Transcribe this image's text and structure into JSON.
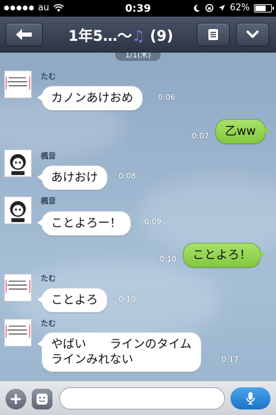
{
  "status_bar": {
    "carrier": "au",
    "time": "0:39",
    "battery_text": "62%",
    "battery_level": 0.62
  },
  "header": {
    "title": "1年5…〜",
    "title_note": "♫",
    "member_count": "(9)"
  },
  "date_label": "1/1(木)",
  "messages": [
    {
      "sender": "たむ",
      "text": "カノンあけおめ",
      "time": "0:06"
    },
    {
      "text": "乙ww",
      "time": "0:07"
    },
    {
      "sender": "楓音",
      "text": "あけおけ",
      "time": "0:08"
    },
    {
      "sender": "楓音",
      "text": "ことよろー！",
      "time": "0:09"
    },
    {
      "text": "ことよろ！",
      "time": "0:10"
    },
    {
      "sender": "たむ",
      "text": "ことよろ",
      "time": "0:10"
    },
    {
      "sender": "たむ",
      "text_line1": "やばい　　ラインのタイム",
      "text_line2": "ラインみれない",
      "time": "0:17"
    }
  ],
  "input": {
    "placeholder": ""
  },
  "colors": {
    "header": "#3a4354",
    "sent_bubble": "#8fd04c",
    "mic_button": "#1c74c9"
  }
}
